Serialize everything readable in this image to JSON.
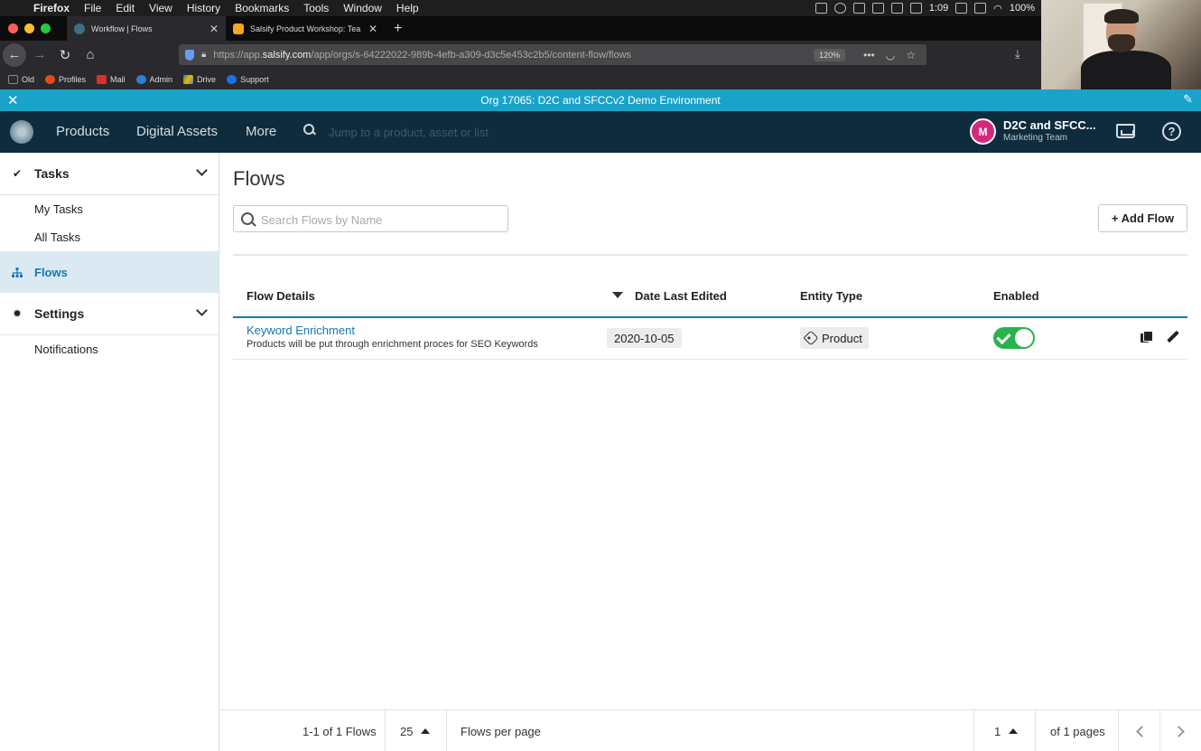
{
  "macos_menu": {
    "apple": "",
    "items": [
      "Firefox",
      "File",
      "Edit",
      "View",
      "History",
      "Bookmarks",
      "Tools",
      "Window",
      "Help"
    ],
    "clock": "1:09",
    "battery": "100%"
  },
  "browser": {
    "tabs": [
      {
        "label": "Workflow | Flows",
        "close": "✕"
      },
      {
        "label": "Salsify Product Workshop: Tea",
        "close": "✕"
      }
    ],
    "new_tab": "+",
    "url_prefix": "https://app.",
    "url_domain": "salsify.com",
    "url_path": "/app/orgs/s-64222022-989b-4efb-a309-d3c5e453c2b5/content-flow/flows",
    "zoom": "120%",
    "bookmarks": [
      {
        "label": "Old",
        "color": "#8a8a8a"
      },
      {
        "label": "Profiles",
        "color": "#e8491d"
      },
      {
        "label": "Mail",
        "color": "#d93025"
      },
      {
        "label": "Admin",
        "color": "#2f7fd1"
      },
      {
        "label": "Drive",
        "color": "#f4b400"
      },
      {
        "label": "Support",
        "color": "#1a73e8"
      }
    ]
  },
  "org_banner": {
    "text": "Org 17065: D2C and SFCCv2 Demo Environment",
    "close": "✕",
    "wand": "✎",
    "color": "#1aa3c8"
  },
  "header": {
    "nav": [
      "Products",
      "Digital Assets",
      "More"
    ],
    "search_placeholder": "Jump to a product, asset or list",
    "avatar_initial": "M",
    "org_name": "D2C and SFCC...",
    "team": "Marketing Team",
    "help": "?"
  },
  "sidebar": {
    "tasks": {
      "label": "Tasks",
      "icon": "✔"
    },
    "task_items": [
      "My Tasks",
      "All Tasks"
    ],
    "flows": {
      "label": "Flows"
    },
    "settings": {
      "label": "Settings",
      "icon": "✹"
    },
    "settings_items": [
      "Notifications"
    ]
  },
  "main": {
    "title": "Flows",
    "search_placeholder": "Search Flows by Name",
    "add_button": "+ Add Flow",
    "columns": {
      "details": "Flow Details",
      "date": "Date Last Edited",
      "entity": "Entity Type",
      "enabled": "Enabled"
    },
    "rows": [
      {
        "name": "Keyword Enrichment",
        "description": "Products will be put through enrichment proces for SEO Keywords",
        "date": "2020-10-05",
        "entity": "Product",
        "enabled": true
      }
    ]
  },
  "footer": {
    "range": "1-1 of 1 Flows",
    "per_page_value": "25",
    "per_page_label": "Flows per page",
    "page": "1",
    "of_pages": "of 1 pages"
  }
}
